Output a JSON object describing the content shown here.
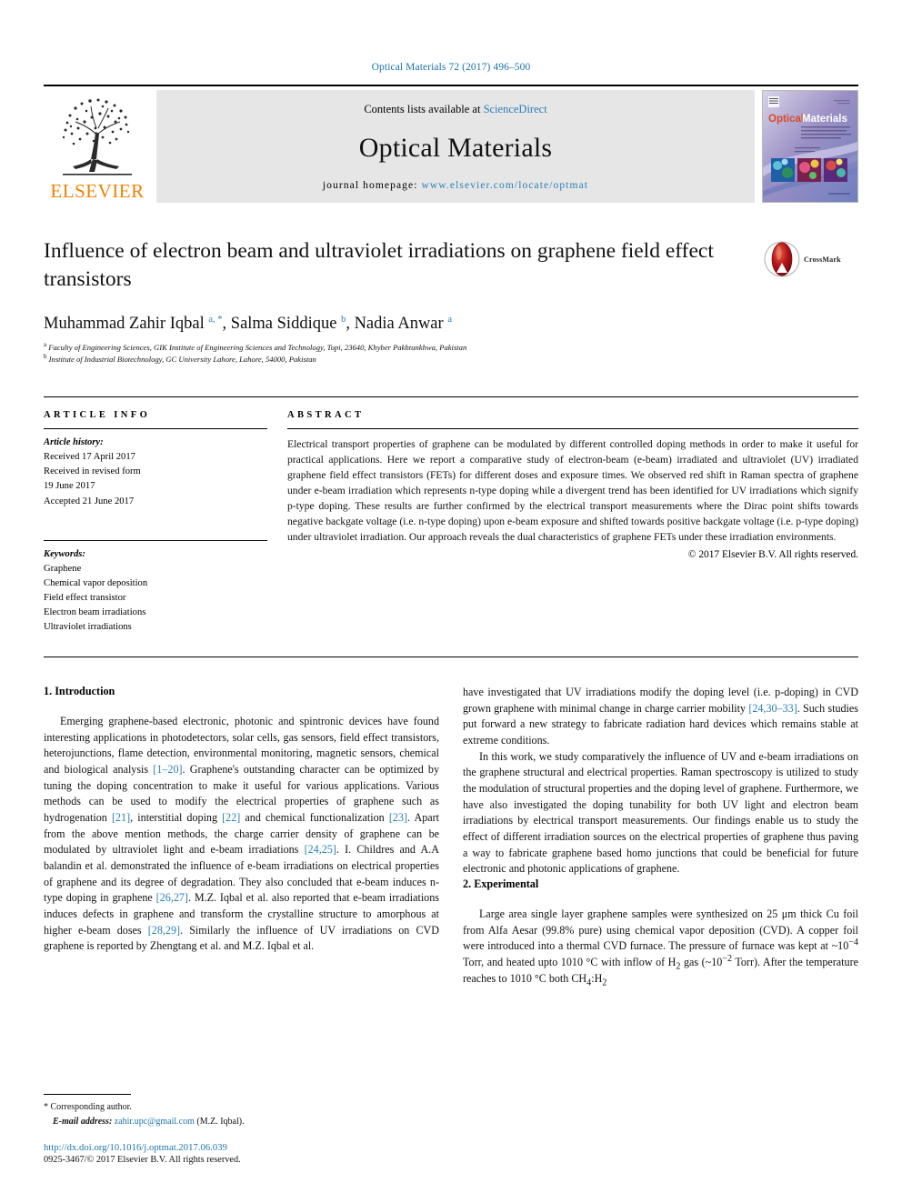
{
  "running_head": "Optical Materials 72 (2017) 496–500",
  "masthead": {
    "publisher": "ELSEVIER",
    "contents_prefix": "Contents lists available at ",
    "contents_link": "ScienceDirect",
    "journal_title": "Optical Materials",
    "homepage_prefix": "journal homepage: ",
    "homepage_url": "www.elsevier.com/locate/optmat",
    "cover": {
      "title_part1": "Optical",
      "title_part2": "Materials"
    }
  },
  "article": {
    "title": "Influence of electron beam and ultraviolet irradiations on graphene field effect transistors",
    "crossmark_label": "CrossMark",
    "authors_html": "Muhammad Zahir Iqbal <sup>a, *</sup>, Salma Siddique <sup>b</sup>, Nadia Anwar <sup>a</sup>",
    "affiliation_a": "Faculty of Engineering Sciences, GIK Institute of Engineering Sciences and Technology, Topi, 23640, Khyber Pakhtunkhwa, Pakistan",
    "affiliation_b": "Institute of Industrial Biotechnology, GC University Lahore, Lahore, 54000, Pakistan"
  },
  "article_info": {
    "heading": "ARTICLE INFO",
    "history_label": "Article history:",
    "history": [
      "Received 17 April 2017",
      "Received in revised form",
      "19 June 2017",
      "Accepted 21 June 2017"
    ],
    "keywords_label": "Keywords:",
    "keywords": [
      "Graphene",
      "Chemical vapor deposition",
      "Field effect transistor",
      "Electron beam irradiations",
      "Ultraviolet irradiations"
    ]
  },
  "abstract": {
    "heading": "ABSTRACT",
    "text": "Electrical transport properties of graphene can be modulated by different controlled doping methods in order to make it useful for practical applications. Here we report a comparative study of electron-beam (e-beam) irradiated and ultraviolet (UV) irradiated graphene field effect transistors (FETs) for different doses and exposure times. We observed red shift in Raman spectra of graphene under e-beam irradiation which represents n-type doping while a divergent trend has been identified for UV irradiations which signify p-type doping. These results are further confirmed by the electrical transport measurements where the Dirac point shifts towards negative backgate voltage (i.e. n-type doping) upon e-beam exposure and shifted towards positive backgate voltage (i.e. p-type doping) under ultraviolet irradiation. Our approach reveals the dual characteristics of graphene FETs under these irradiation environments.",
    "copyright": "© 2017 Elsevier B.V. All rights reserved."
  },
  "sections": {
    "introduction": {
      "heading": "1. Introduction",
      "paragraph1_parts": [
        "Emerging graphene-based electronic, photonic and spintronic devices have found interesting applications in photodetectors, solar cells, gas sensors, field effect transistors, heterojunctions, flame detection, environmental monitoring, magnetic sensors, chemical and biological analysis ",
        "[1–20]",
        ". Graphene's outstanding character can be optimized by tuning the doping concentration to make it useful for various applications. Various methods can be used to modify the electrical properties of graphene such as hydrogenation ",
        "[21]",
        ", interstitial doping ",
        "[22]",
        " and chemical functionalization ",
        "[23]",
        ". Apart from the above mention methods, the charge carrier density of graphene can be modulated by ultraviolet light and e-beam irradiations ",
        "[24,25]",
        ". I. Childres and A.A balandin et al. demonstrated the influence of e-beam irradiations on electrical properties of graphene and its degree of degradation. They also concluded that e-beam induces n-type doping in graphene ",
        "[26,27]",
        ". M.Z. Iqbal et al. also reported that e-beam irradiations induces defects in graphene and transform the crystalline structure to amorphous at higher e-beam doses ",
        "[28,29]",
        ". Similarly the influence of UV irradiations on CVD graphene is reported by Zhengtang et al. and M.Z. Iqbal et al. "
      ],
      "paragraph2_parts": [
        "have investigated that UV irradiations modify the doping level (i.e. p-doping) in CVD grown graphene with minimal change in charge carrier mobility ",
        "[24,30–33]",
        ". Such studies put forward a new strategy to fabricate radiation hard devices which remains stable at extreme conditions."
      ],
      "paragraph3": "In this work, we study comparatively the influence of UV and e-beam irradiations on the graphene structural and electrical properties. Raman spectroscopy is utilized to study the modulation of structural properties and the doping level of graphene. Furthermore, we have also investigated the doping tunability for both UV light and electron beam irradiations by electrical transport measurements. Our findings enable us to study the effect of different irradiation sources on the electrical properties of graphene thus paving a way to fabricate graphene based homo junctions that could be beneficial for future electronic and photonic applications of graphene."
    },
    "experimental": {
      "heading": "2. Experimental",
      "paragraph1_html": "Large area single layer graphene samples were synthesized on 25 &mu;m thick Cu foil from Alfa Aesar (99.8% pure) using chemical vapor deposition (CVD). A copper foil were introduced into a thermal CVD furnace. The pressure of furnace was kept at ~10<sup>&minus;4</sup> Torr, and heated upto 1010 &deg;C with inflow of H<sub>2</sub> gas (~10<sup>&minus;2</sup> Torr). After the temperature reaches to 1010 &deg;C both CH<sub>4</sub>:H<sub>2</sub>"
    }
  },
  "footnote": {
    "corresponding_marker": "*",
    "corresponding_text": "Corresponding author.",
    "email_label": "E-mail address:",
    "email": "zahir.upc@gmail.com",
    "email_owner": "(M.Z. Iqbal).",
    "doi": "http://dx.doi.org/10.1016/j.optmat.2017.06.039",
    "issn_line": "0925-3467/© 2017 Elsevier B.V. All rights reserved."
  },
  "colors": {
    "link": "#1b74a8",
    "elsevier_orange": "#ef8200",
    "masthead_bg": "#e6e6e6"
  }
}
